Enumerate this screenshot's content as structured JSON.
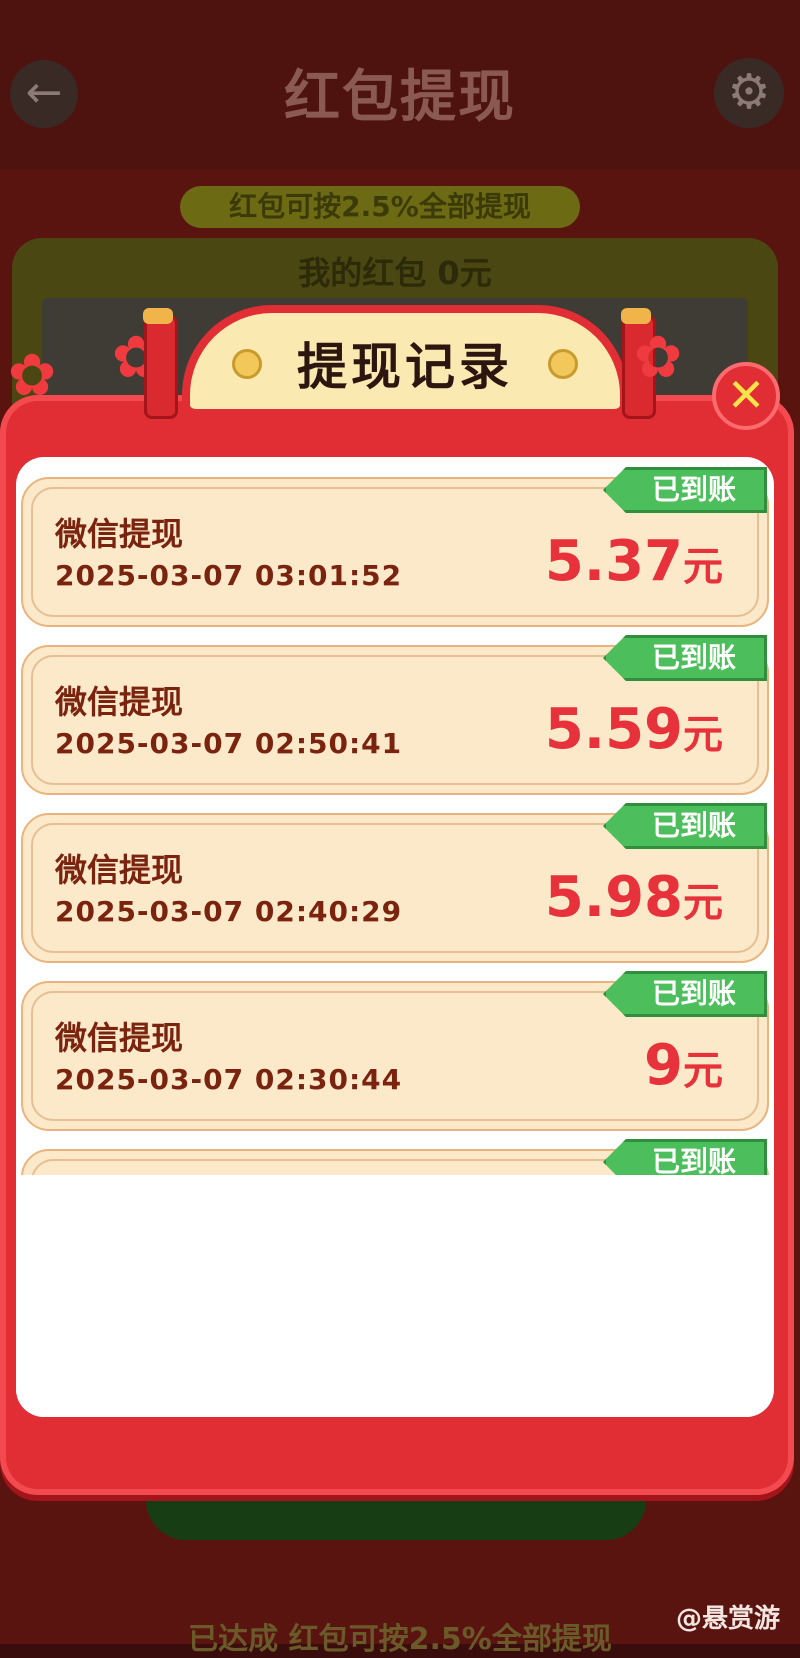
{
  "background": {
    "back_icon": "back-arrow-icon",
    "title": "红包提现",
    "settings_icon": "gear-icon",
    "pill_text": "红包可按2.5%全部提现",
    "card_header": "我的红包 0元",
    "bottom_text": "已达成 红包可按2.5%全部提现"
  },
  "modal": {
    "title": "提现记录",
    "close_label": "✕",
    "records": [
      {
        "title": "微信提现",
        "time": "2025-03-07 03:01:52",
        "amount": "5.37",
        "unit": "元",
        "status": "已到账"
      },
      {
        "title": "微信提现",
        "time": "2025-03-07 02:50:41",
        "amount": "5.59",
        "unit": "元",
        "status": "已到账"
      },
      {
        "title": "微信提现",
        "time": "2025-03-07 02:40:29",
        "amount": "5.98",
        "unit": "元",
        "status": "已到账"
      },
      {
        "title": "微信提现",
        "time": "2025-03-07 02:30:44",
        "amount": "9",
        "unit": "元",
        "status": "已到账"
      },
      {
        "title": "",
        "time": "",
        "amount": "",
        "unit": "",
        "status": "已到账"
      }
    ]
  },
  "watermark": "@悬赏游",
  "colors": {
    "modal_red": "#e12d34",
    "record_bg": "#fce9c9",
    "amount_red": "#e7313b",
    "badge_green": "#4dbe5c",
    "text_brown": "#7a2410"
  }
}
